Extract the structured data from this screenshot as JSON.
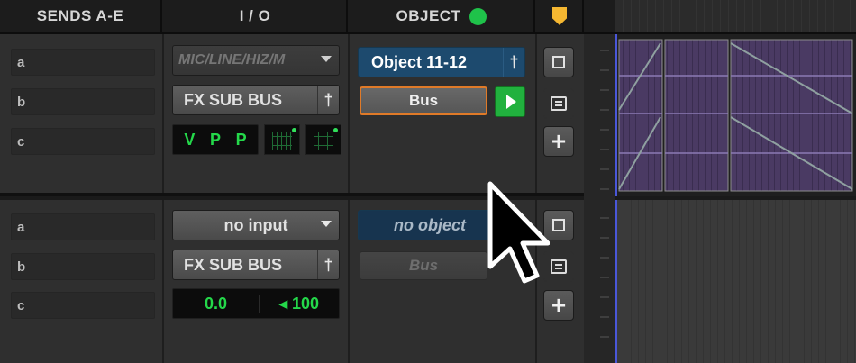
{
  "header": {
    "sends": "SENDS A-E",
    "io": "I / O",
    "object": "OBJECT"
  },
  "track1": {
    "sends": [
      "a",
      "b",
      "c"
    ],
    "input": "MIC/LINE/HIZ/M",
    "output": "FX SUB BUS",
    "output_pin": "†",
    "voice": [
      "V",
      "P",
      "P"
    ],
    "object": "Object 11-12",
    "object_pin": "†",
    "bus": "Bus"
  },
  "track2": {
    "sends": [
      "a",
      "b",
      "c"
    ],
    "input": "no input",
    "output": "FX SUB BUS",
    "output_pin": "†",
    "volume": "0.0",
    "pan": "◂ 100",
    "object": "no object",
    "bus": "Bus"
  },
  "icons": {
    "status": "green-dot",
    "marker": "orange-marker",
    "track_options": "square-icon",
    "comments": "list-icon",
    "add": "plus-icon",
    "playback": "play-icon"
  },
  "colors": {
    "accent_orange": "#e07a28",
    "status_green": "#1fc24a",
    "object_blue": "#1d4a6e",
    "clip_purple": "#4a3a63"
  }
}
